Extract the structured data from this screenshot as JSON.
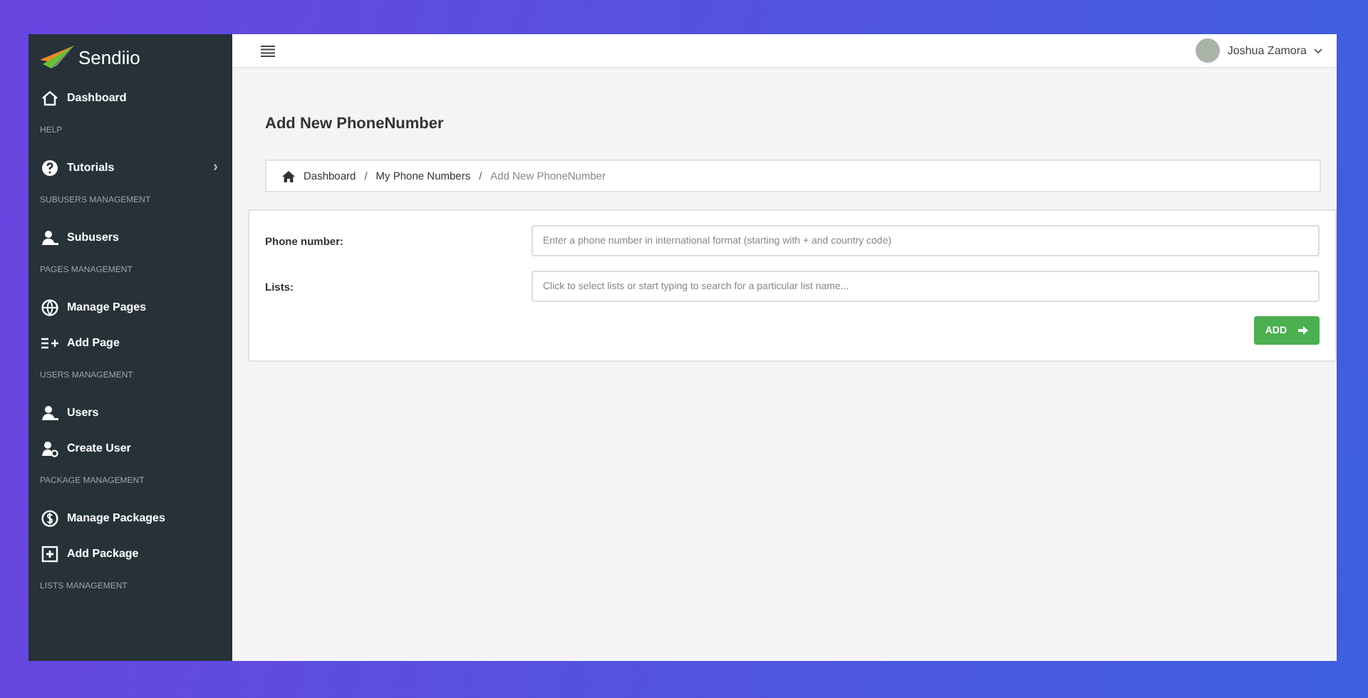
{
  "sidebar": {
    "logo": "Sendiio",
    "items": [
      {
        "kind": "link",
        "label": "Dashboard"
      },
      {
        "kind": "header",
        "label": "HELP"
      },
      {
        "kind": "link",
        "label": "Tutorials",
        "chevron": "›"
      },
      {
        "kind": "header",
        "label": "SUBUSERS MANAGEMENT"
      },
      {
        "kind": "link",
        "label": "Subusers"
      },
      {
        "kind": "header",
        "label": "PAGES MANAGEMENT"
      },
      {
        "kind": "link",
        "label": "Manage Pages"
      },
      {
        "kind": "link",
        "label": "Add Page"
      },
      {
        "kind": "header",
        "label": "USERS MANAGEMENT"
      },
      {
        "kind": "link",
        "label": "Users"
      },
      {
        "kind": "link",
        "label": "Create User"
      },
      {
        "kind": "header",
        "label": "PACKAGE MANAGEMENT"
      },
      {
        "kind": "link",
        "label": "Manage Packages"
      },
      {
        "kind": "link",
        "label": "Add Package"
      },
      {
        "kind": "header",
        "label": "LISTS MANAGEMENT"
      }
    ]
  },
  "topbar": {
    "user": "Joshua Zamora"
  },
  "page": {
    "title": "Add New PhoneNumber",
    "breadcrumb_separators": [
      "/",
      "/"
    ],
    "breadcrumb": [
      {
        "label": "Dashboard",
        "current": false
      },
      {
        "label": "My Phone Numbers",
        "current": false
      },
      {
        "label": "Add New PhoneNumber",
        "current": true
      }
    ],
    "fields": [
      {
        "label": "Phone number:",
        "placeholder": "Enter a phone number in international format (starting with + and country code)"
      },
      {
        "label": "Lists:",
        "placeholder": "Click to select lists or start typing to search for a particular list name..."
      }
    ],
    "button": "ADD"
  }
}
